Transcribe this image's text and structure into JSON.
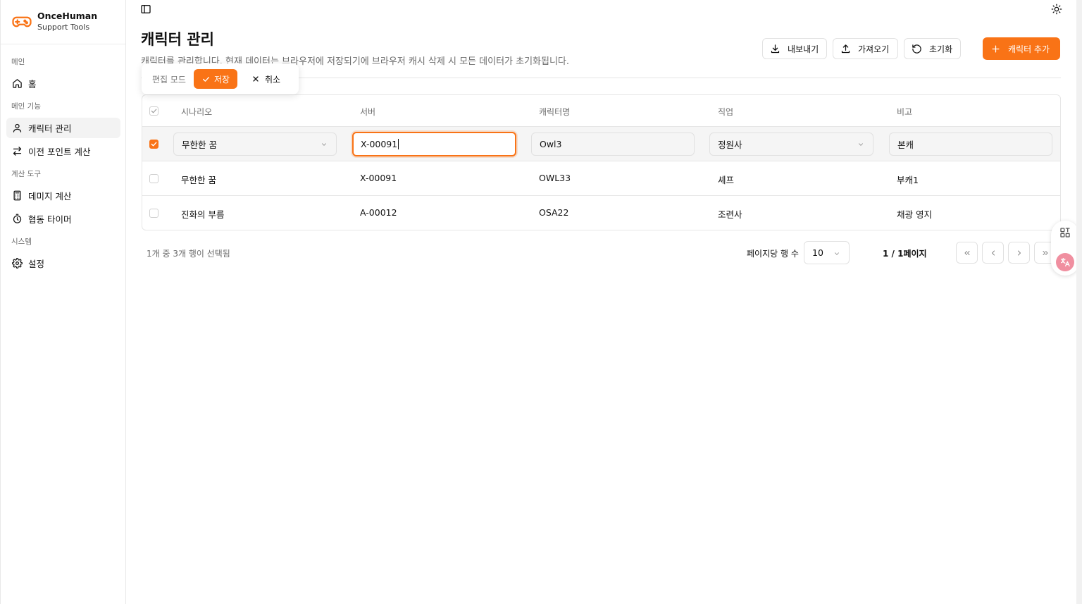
{
  "brand": {
    "name": "OnceHuman",
    "subtitle": "Support Tools"
  },
  "sidebar": {
    "groups": [
      "메인",
      "메인 기능",
      "계산 도구",
      "시스템"
    ],
    "items": [
      {
        "label": "홈",
        "icon": "home-icon"
      },
      {
        "label": "캐릭터 관리",
        "icon": "user-icon",
        "active": true
      },
      {
        "label": "이전 포인트 계산",
        "icon": "arrows-icon"
      },
      {
        "label": "데미지 계산",
        "icon": "calculator-icon"
      },
      {
        "label": "협동 타이머",
        "icon": "timer-icon"
      },
      {
        "label": "설정",
        "icon": "gear-icon"
      }
    ]
  },
  "header": {
    "title": "캐릭터 관리",
    "description": "캐릭터를 관리합니다. 현재 데이터는 브라우저에 저장되기에 브라우저 캐시 삭제 시 모든 데이터가 초기화됩니다.",
    "export_label": "내보내기",
    "import_label": "가져오기",
    "reset_label": "초기화",
    "add_label": "캐릭터 추가"
  },
  "edit_popover": {
    "label": "편집 모드",
    "save_label": "저장",
    "cancel_label": "취소"
  },
  "table": {
    "columns": [
      "시나리오",
      "서버",
      "캐릭터명",
      "직업",
      "비고"
    ],
    "editing_row": {
      "scenario": "무한한 꿈",
      "server": "X-00091",
      "name": "Owl3",
      "job": "정원사",
      "note": "본캐",
      "checked": true
    },
    "rows": [
      {
        "scenario": "무한한 꿈",
        "server": "X-00091",
        "name": "OWL33",
        "job": "셰프",
        "note": "부캐1"
      },
      {
        "scenario": "진화의 부름",
        "server": "A-00012",
        "name": "OSA22",
        "job": "조련사",
        "note": "채광 영지"
      }
    ]
  },
  "footer": {
    "selection_text": "1개 중 3개 행이 선택됨",
    "rows_per_page_label": "페이지당 행 수",
    "rows_per_page_value": "10",
    "page_info": "1 / 1페이지"
  },
  "colors": {
    "accent": "#f97316",
    "muted_text": "#6b6b6b",
    "border": "#e6e6e6"
  }
}
